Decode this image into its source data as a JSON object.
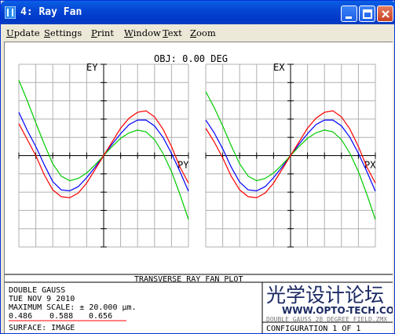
{
  "window": {
    "title": "4: Ray Fan"
  },
  "menu": [
    "Update",
    "Settings",
    "Print",
    "Window",
    "Text",
    "Zoom"
  ],
  "plot": {
    "field_label": "OBJ: 0.00 DEG",
    "plot_title": "TRANSVERSE RAY FAN PLOT"
  },
  "chart_data": [
    {
      "type": "line",
      "y_label": "EY",
      "x_label": "PY",
      "xlim": [
        -1,
        1
      ],
      "ylim": [
        -20,
        20
      ],
      "grid": true,
      "series": [
        {
          "name": "0.486",
          "color": "#0000ff",
          "x": [
            -1,
            -0.9,
            -0.8,
            -0.7,
            -0.6,
            -0.5,
            -0.4,
            -0.3,
            -0.2,
            -0.1,
            0,
            0.1,
            0.2,
            0.3,
            0.4,
            0.5,
            0.6,
            0.7,
            0.8,
            0.9,
            1
          ],
          "y": [
            9.5,
            5.5,
            2.0,
            -2.0,
            -5.7,
            -7.5,
            -7.7,
            -6.8,
            -4.8,
            -2.5,
            0,
            2.5,
            4.8,
            6.8,
            7.8,
            7.8,
            6.5,
            4.0,
            0.5,
            -3.5,
            -7.8
          ]
        },
        {
          "name": "0.588",
          "color": "#00cc00",
          "x": [
            -1,
            -0.9,
            -0.8,
            -0.7,
            -0.6,
            -0.5,
            -0.4,
            -0.3,
            -0.2,
            -0.1,
            0,
            0.1,
            0.2,
            0.3,
            0.4,
            0.5,
            0.6,
            0.7,
            0.8,
            0.9,
            1
          ],
          "y": [
            16.5,
            12.0,
            7.2,
            2.5,
            -1.8,
            -4.5,
            -5.5,
            -5.0,
            -3.8,
            -2.0,
            0,
            2.0,
            3.8,
            5.0,
            5.6,
            5.2,
            3.5,
            0.5,
            -3.5,
            -8.5,
            -14.0
          ]
        },
        {
          "name": "0.656",
          "color": "#ff0000",
          "x": [
            -1,
            -0.9,
            -0.8,
            -0.7,
            -0.6,
            -0.5,
            -0.4,
            -0.3,
            -0.2,
            -0.1,
            0,
            0.1,
            0.2,
            0.3,
            0.4,
            0.5,
            0.6,
            0.7,
            0.8,
            0.9,
            1
          ],
          "y": [
            7.0,
            3.5,
            0.0,
            -4.2,
            -7.5,
            -9.0,
            -9.2,
            -8.2,
            -6.0,
            -3.0,
            0,
            3.0,
            6.0,
            8.2,
            9.5,
            9.8,
            8.5,
            5.8,
            2.0,
            -2.5,
            -6.0
          ]
        }
      ]
    },
    {
      "type": "line",
      "y_label": "EX",
      "x_label": "PX",
      "xlim": [
        -1,
        1
      ],
      "ylim": [
        -20,
        20
      ],
      "grid": true,
      "series": [
        {
          "name": "0.486",
          "color": "#0000ff",
          "x": [
            -1,
            -0.9,
            -0.8,
            -0.7,
            -0.6,
            -0.5,
            -0.4,
            -0.3,
            -0.2,
            -0.1,
            0,
            0.1,
            0.2,
            0.3,
            0.4,
            0.5,
            0.6,
            0.7,
            0.8,
            0.9,
            1
          ],
          "y": [
            7.8,
            5.0,
            1.5,
            -2.5,
            -5.8,
            -7.5,
            -7.7,
            -6.8,
            -4.8,
            -2.5,
            0,
            2.5,
            4.8,
            6.8,
            7.8,
            7.8,
            6.5,
            4.0,
            0.5,
            -3.5,
            -7.8
          ]
        },
        {
          "name": "0.588",
          "color": "#00cc00",
          "x": [
            -1,
            -0.9,
            -0.8,
            -0.7,
            -0.6,
            -0.5,
            -0.4,
            -0.3,
            -0.2,
            -0.1,
            0,
            0.1,
            0.2,
            0.3,
            0.4,
            0.5,
            0.6,
            0.7,
            0.8,
            0.9,
            1
          ],
          "y": [
            14.0,
            10.5,
            6.5,
            2.2,
            -1.8,
            -4.5,
            -5.5,
            -5.0,
            -3.8,
            -2.0,
            0,
            2.0,
            3.8,
            5.0,
            5.6,
            5.2,
            3.5,
            0.5,
            -3.5,
            -8.5,
            -14.0
          ]
        },
        {
          "name": "0.656",
          "color": "#ff0000",
          "x": [
            -1,
            -0.9,
            -0.8,
            -0.7,
            -0.6,
            -0.5,
            -0.4,
            -0.3,
            -0.2,
            -0.1,
            0,
            0.1,
            0.2,
            0.3,
            0.4,
            0.5,
            0.6,
            0.7,
            0.8,
            0.9,
            1
          ],
          "y": [
            6.0,
            3.0,
            -0.5,
            -4.5,
            -7.5,
            -9.0,
            -9.2,
            -8.2,
            -6.0,
            -3.0,
            0,
            3.0,
            6.0,
            8.2,
            9.5,
            9.8,
            8.5,
            5.8,
            2.0,
            -2.5,
            -6.0
          ]
        }
      ]
    }
  ],
  "info": {
    "lens_name": "DOUBLE GAUSS",
    "date": "TUE NOV 9 2010",
    "max_scale": "MAXIMUM SCALE: ± 20.000 µm.",
    "wavelengths": [
      {
        "value": "0.486",
        "color": "#0000ff"
      },
      {
        "value": "0.588",
        "color": "#00cc00"
      },
      {
        "value": "0.656",
        "color": "#ff0000"
      }
    ],
    "surface": "SURFACE: IMAGE",
    "file_label": "DOUBLE GAUSS 28 DEGREE FIELD.ZMX",
    "configuration": "CONFIGURATION 1 OF 1"
  },
  "watermark": {
    "chinese": "光学设计论坛",
    "url": "WWW.OPTO-TECH.COM"
  }
}
